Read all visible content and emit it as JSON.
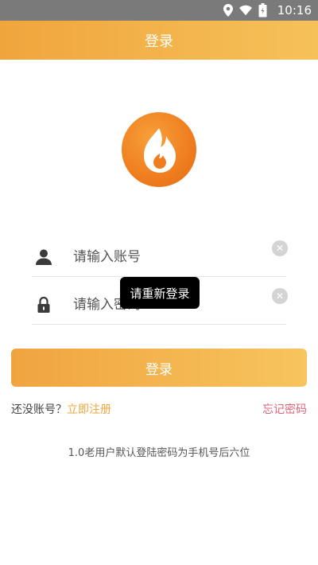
{
  "status_bar": {
    "time": "10:16",
    "icons": [
      "location-icon",
      "wifi-icon",
      "battery-icon"
    ]
  },
  "header": {
    "title": "登录"
  },
  "logo": {
    "icon": "flame-logo-icon",
    "colors": [
      "#ef7d1f",
      "#ffffff"
    ]
  },
  "form": {
    "account_placeholder": "请输入账号",
    "password_placeholder": "请输入密码",
    "account_icon": "user-icon",
    "password_icon": "lock-icon",
    "clear_icon": "clear-icon"
  },
  "toast": {
    "message": "请重新登录"
  },
  "login_button": {
    "label": "登录"
  },
  "links": {
    "no_account_text": "还没账号？",
    "register_label": "立即注册",
    "forgot_label": "忘记密码"
  },
  "hint": "1.0老用户默认登陆密码为手机号后六位",
  "colors": {
    "accent": "#f0a53c",
    "status_bar": "#7a7a7a",
    "forgot": "#e0657a"
  }
}
